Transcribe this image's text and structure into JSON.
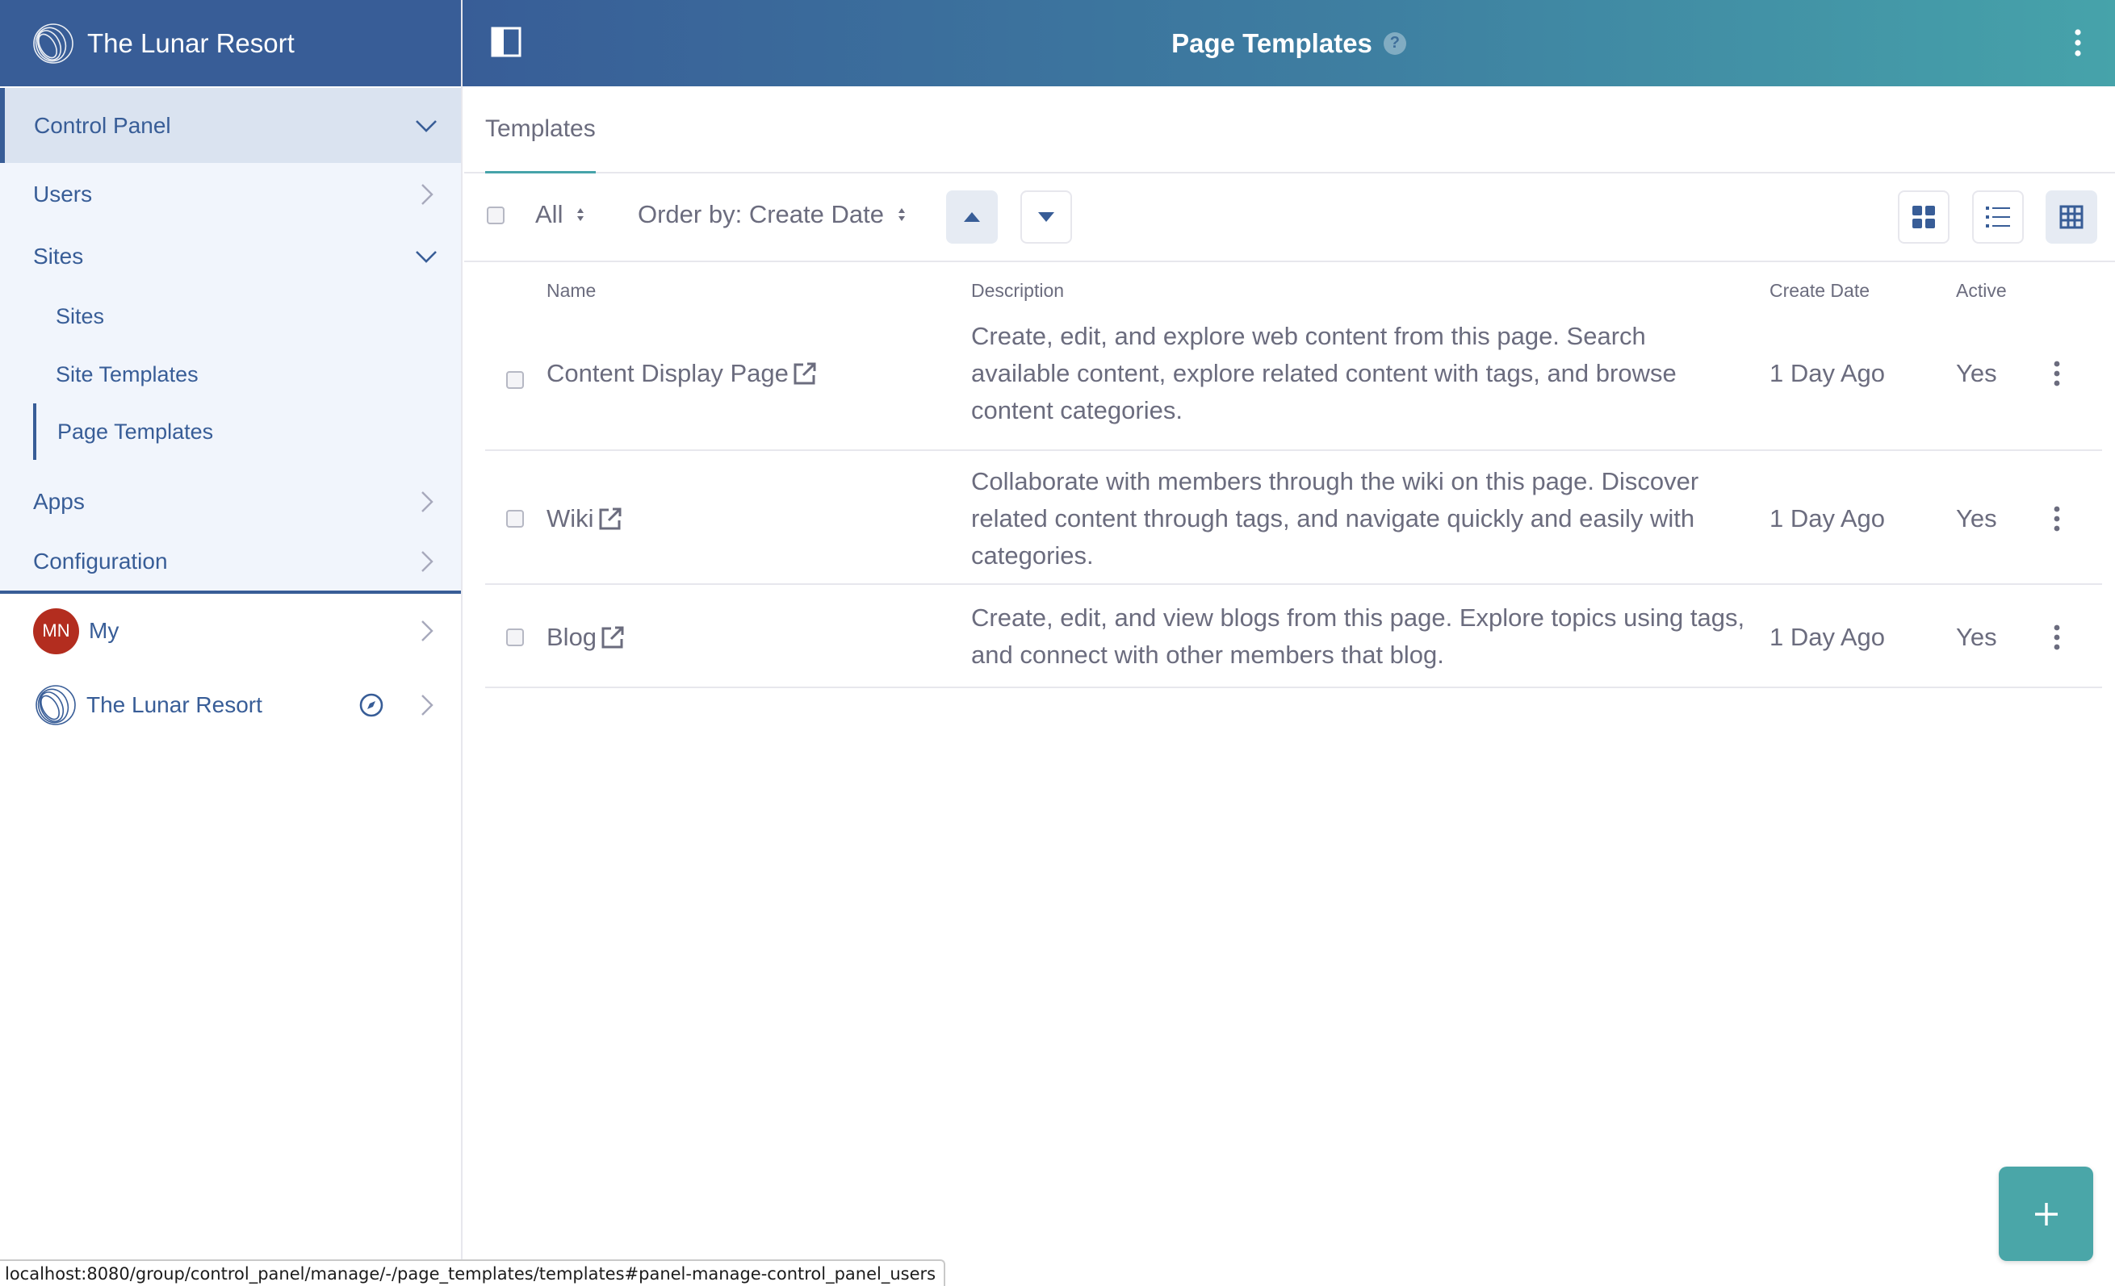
{
  "sidebar": {
    "brand": "The Lunar Resort",
    "control_panel": "Control Panel",
    "items": {
      "users": "Users",
      "sites": "Sites",
      "sites_sub": [
        "Sites",
        "Site Templates",
        "Page Templates"
      ],
      "apps": "Apps",
      "configuration": "Configuration"
    },
    "my": {
      "avatar_initials": "MN",
      "label": "My"
    },
    "site": {
      "label": "The Lunar Resort"
    }
  },
  "header": {
    "title": "Page Templates",
    "help_icon": "question-circle-icon",
    "help_glyph": "?"
  },
  "nav": {
    "tab": "Templates"
  },
  "toolbar": {
    "filter_label": "All",
    "order_label": "Order by: Create Date"
  },
  "table": {
    "columns": [
      "Name",
      "Description",
      "Create Date",
      "Active"
    ],
    "rows": [
      {
        "name": "Content Display Page",
        "description": "Create, edit, and explore web content from this page. Search available content, explore related content with tags, and browse content categories.",
        "create_date": "1 Day Ago",
        "active": "Yes"
      },
      {
        "name": "Wiki",
        "description": "Collaborate with members through the wiki on this page. Discover related content through tags, and navigate quickly and easily with categories.",
        "create_date": "1 Day Ago",
        "active": "Yes"
      },
      {
        "name": "Blog",
        "description": "Create, edit, and view blogs from this page. Explore topics using tags, and connect with other members that blog.",
        "create_date": "1 Day Ago",
        "active": "Yes"
      }
    ]
  },
  "fab": {
    "glyph": "+"
  },
  "status_url": "localhost:8080/group/control_panel/manage/-/page_templates/templates#panel-manage-control_panel_users",
  "colors": {
    "primary": "#385d97",
    "header_gradient_end": "#46a3aa",
    "fab": "#4aa6a8",
    "avatar": "#b32d1f"
  }
}
